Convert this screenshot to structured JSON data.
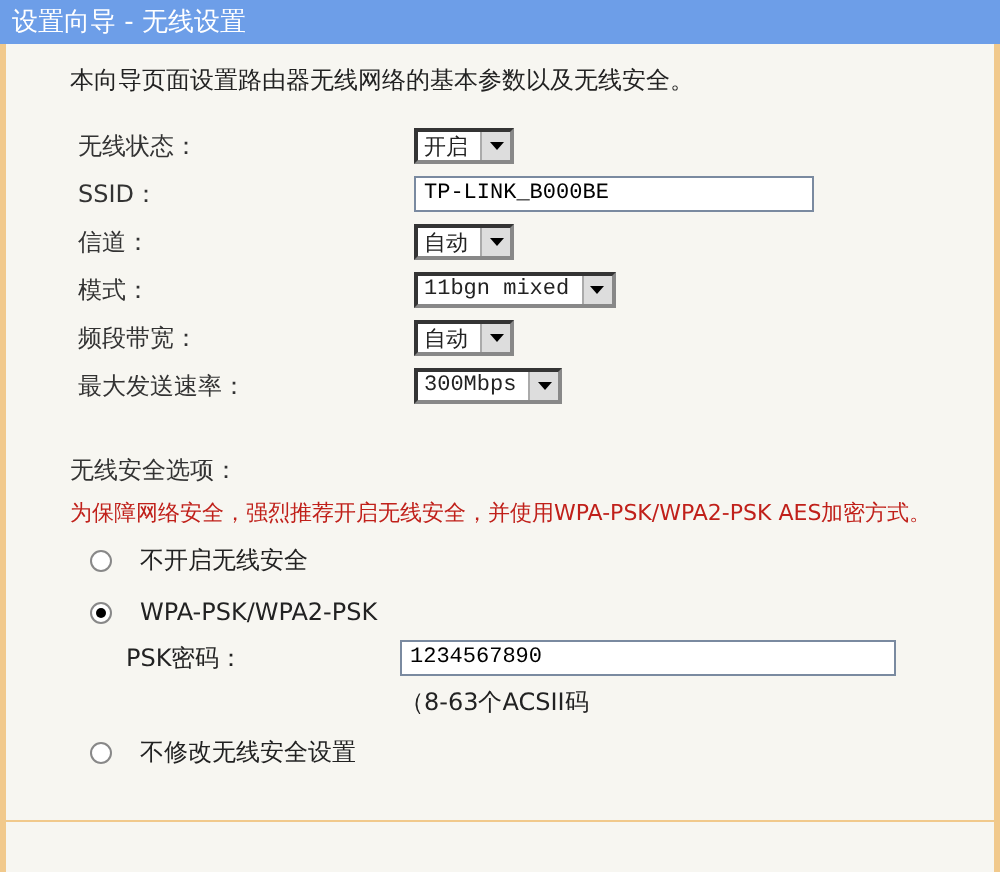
{
  "window": {
    "title": "设置向导 - 无线设置"
  },
  "description": "本向导页面设置路由器无线网络的基本参数以及无线安全。",
  "fields": [
    {
      "kind": "select",
      "label": "无线状态：",
      "value": "开启"
    },
    {
      "kind": "text",
      "label": "SSID：",
      "value": "TP-LINK_B000BE"
    },
    {
      "kind": "select",
      "label": "信道：",
      "value": "自动"
    },
    {
      "kind": "select",
      "label": "模式：",
      "value": "11bgn mixed"
    },
    {
      "kind": "select",
      "label": "频段带宽：",
      "value": "自动"
    },
    {
      "kind": "select",
      "label": "最大发送速率：",
      "value": "300Mbps"
    }
  ],
  "security": {
    "heading": "无线安全选项：",
    "warning": "为保障网络安全，强烈推荐开启无线安全，并使用WPA-PSK/WPA2-PSK AES加密方式。",
    "options": [
      {
        "label": "不开启无线安全",
        "selected": false
      },
      {
        "label": "WPA-PSK/WPA2-PSK",
        "selected": true,
        "psk_label": "PSK密码：",
        "psk_value": "1234567890",
        "hint": "（8-63个ACSII码"
      },
      {
        "label": "不修改无线安全设置",
        "selected": false
      }
    ]
  }
}
